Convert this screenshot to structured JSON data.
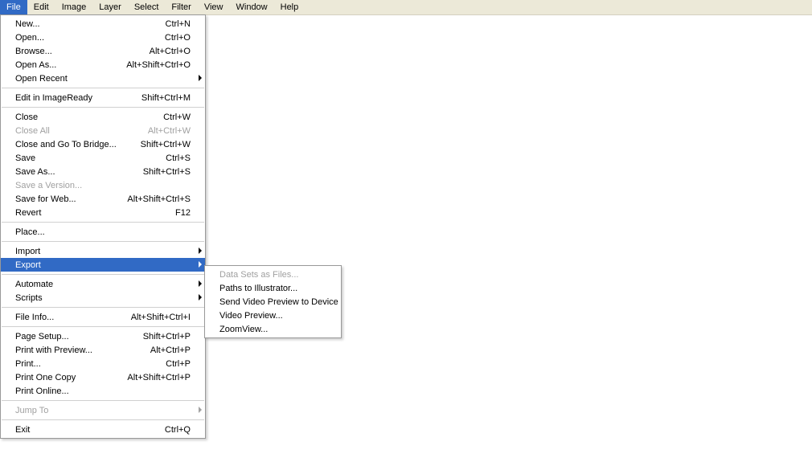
{
  "colors": {
    "highlight": "#316ac5",
    "menubar_bg": "#ece9d8"
  },
  "menubar": {
    "items": [
      {
        "label": "File",
        "active": true
      },
      {
        "label": "Edit"
      },
      {
        "label": "Image"
      },
      {
        "label": "Layer"
      },
      {
        "label": "Select"
      },
      {
        "label": "Filter"
      },
      {
        "label": "View"
      },
      {
        "label": "Window"
      },
      {
        "label": "Help"
      }
    ]
  },
  "file_menu": {
    "groups": [
      [
        {
          "label": "New...",
          "shortcut": "Ctrl+N"
        },
        {
          "label": "Open...",
          "shortcut": "Ctrl+O"
        },
        {
          "label": "Browse...",
          "shortcut": "Alt+Ctrl+O"
        },
        {
          "label": "Open As...",
          "shortcut": "Alt+Shift+Ctrl+O"
        },
        {
          "label": "Open Recent",
          "submenu": true
        }
      ],
      [
        {
          "label": "Edit in ImageReady",
          "shortcut": "Shift+Ctrl+M"
        }
      ],
      [
        {
          "label": "Close",
          "shortcut": "Ctrl+W"
        },
        {
          "label": "Close All",
          "shortcut": "Alt+Ctrl+W",
          "disabled": true
        },
        {
          "label": "Close and Go To Bridge...",
          "shortcut": "Shift+Ctrl+W"
        },
        {
          "label": "Save",
          "shortcut": "Ctrl+S"
        },
        {
          "label": "Save As...",
          "shortcut": "Shift+Ctrl+S"
        },
        {
          "label": "Save a Version...",
          "disabled": true
        },
        {
          "label": "Save for Web...",
          "shortcut": "Alt+Shift+Ctrl+S"
        },
        {
          "label": "Revert",
          "shortcut": "F12"
        }
      ],
      [
        {
          "label": "Place..."
        }
      ],
      [
        {
          "label": "Import",
          "submenu": true
        },
        {
          "label": "Export",
          "submenu": true,
          "highlight": true
        }
      ],
      [
        {
          "label": "Automate",
          "submenu": true
        },
        {
          "label": "Scripts",
          "submenu": true
        }
      ],
      [
        {
          "label": "File Info...",
          "shortcut": "Alt+Shift+Ctrl+I"
        }
      ],
      [
        {
          "label": "Page Setup...",
          "shortcut": "Shift+Ctrl+P"
        },
        {
          "label": "Print with Preview...",
          "shortcut": "Alt+Ctrl+P"
        },
        {
          "label": "Print...",
          "shortcut": "Ctrl+P"
        },
        {
          "label": "Print One Copy",
          "shortcut": "Alt+Shift+Ctrl+P"
        },
        {
          "label": "Print Online..."
        }
      ],
      [
        {
          "label": "Jump To",
          "submenu": true,
          "disabled": true
        }
      ],
      [
        {
          "label": "Exit",
          "shortcut": "Ctrl+Q"
        }
      ]
    ]
  },
  "export_menu": {
    "items": [
      {
        "label": "Data Sets as Files...",
        "disabled": true
      },
      {
        "label": "Paths to Illustrator..."
      },
      {
        "label": "Send Video Preview to Device"
      },
      {
        "label": "Video Preview..."
      },
      {
        "label": "ZoomView..."
      }
    ]
  }
}
